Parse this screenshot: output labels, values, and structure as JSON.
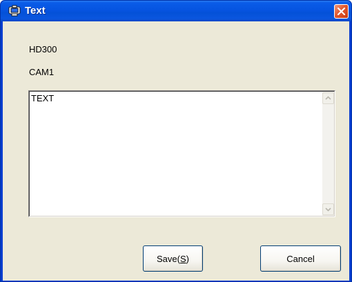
{
  "window": {
    "title": "Text",
    "close_label": "close"
  },
  "labels": {
    "device": "HD300",
    "camera": "CAM1"
  },
  "text_area": {
    "value": "TEXT"
  },
  "buttons": {
    "save_prefix": "Save(",
    "save_mnemonic": "S",
    "save_suffix": ")",
    "cancel": "Cancel"
  },
  "colors": {
    "titlebar": "#0654e0",
    "client_background": "#ece9d8",
    "close_button": "#e2582f",
    "button_border": "#003c74"
  },
  "icons": {
    "app": "text-window-icon",
    "close": "close-icon",
    "scroll_up": "scroll-up-arrow-icon",
    "scroll_down": "scroll-down-arrow-icon"
  }
}
